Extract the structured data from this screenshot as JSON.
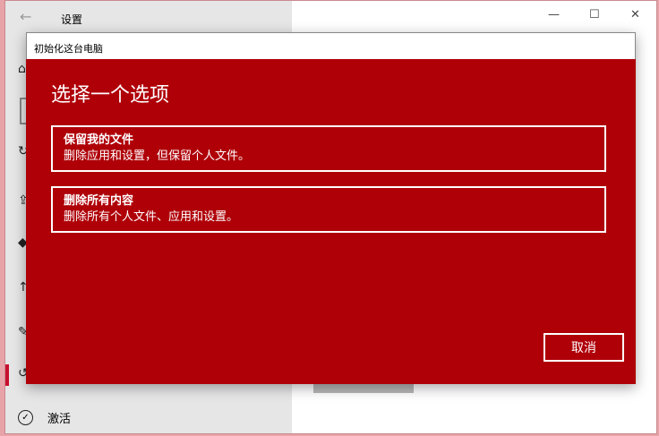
{
  "settings": {
    "title": "设置",
    "activate_label": "激活",
    "minimize": "—",
    "maximize": "☐",
    "close": "✕"
  },
  "dialog": {
    "title": "初始化这台电脑",
    "heading": "选择一个选项",
    "options": [
      {
        "title": "保留我的文件",
        "desc": "删除应用和设置，但保留个人文件。"
      },
      {
        "title": "删除所有内容",
        "desc": "删除所有个人文件、应用和设置。"
      }
    ],
    "cancel_label": "取消"
  },
  "colors": {
    "dialog_bg": "#af0008",
    "accent": "#c8102e"
  }
}
